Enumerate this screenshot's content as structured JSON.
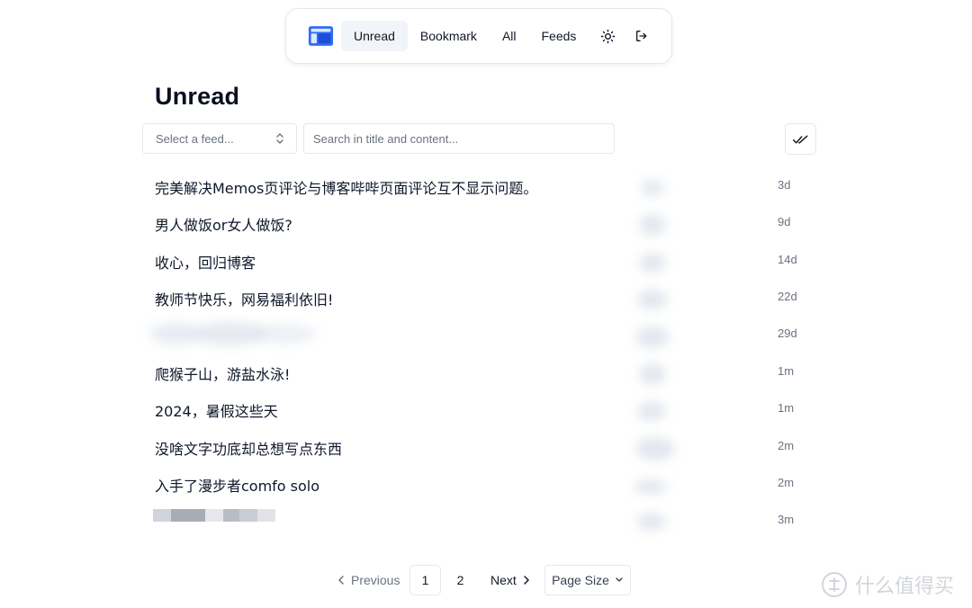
{
  "nav": {
    "items": [
      {
        "label": "Unread",
        "active": true
      },
      {
        "label": "Bookmark",
        "active": false
      },
      {
        "label": "All",
        "active": false
      },
      {
        "label": "Feeds",
        "active": false
      }
    ],
    "logo_icon": "reader-logo-icon",
    "theme_icon": "sun-icon",
    "logout_icon": "logout-icon",
    "accent_color": "#2563eb"
  },
  "page": {
    "title": "Unread"
  },
  "filters": {
    "feed_select_placeholder": "Select a feed...",
    "search_placeholder": "Search in title and content...",
    "mark_all_icon": "double-check-icon"
  },
  "articles": [
    {
      "title": "完美解决Memos页评论与博客哔哔页面评论互不显示问题。",
      "age": "3d"
    },
    {
      "title": "男人做饭or女人做饭?",
      "age": "9d"
    },
    {
      "title": "收心，回归博客",
      "age": "14d"
    },
    {
      "title": "教师节快乐，网易福利依旧!",
      "age": "22d"
    },
    {
      "title": "",
      "age": "29d"
    },
    {
      "title": "爬猴子山，游盐水泳!",
      "age": "1m"
    },
    {
      "title": "2024，暑假这些天",
      "age": "1m"
    },
    {
      "title": "没啥文字功底却总想写点东西",
      "age": "2m"
    },
    {
      "title": "入手了漫步者comfo solo",
      "age": "2m"
    },
    {
      "title": "",
      "age": "3m"
    }
  ],
  "pagination": {
    "previous": "Previous",
    "next": "Next",
    "pages": [
      "1",
      "2"
    ],
    "current": "1",
    "page_size": "Page Size"
  },
  "watermark": {
    "text": "什么值得买",
    "icon": "zhi-logo-icon"
  }
}
